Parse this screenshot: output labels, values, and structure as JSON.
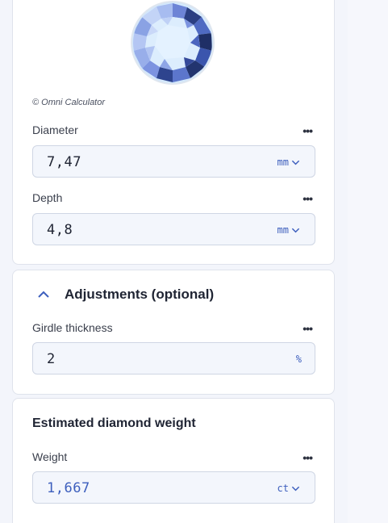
{
  "credit": "© Omni Calculator",
  "icons": {
    "diamond": "diamond-illustration",
    "more": "more-options-icon",
    "chevron": "chevron-down-icon",
    "collapse": "chevron-up-icon"
  },
  "colors": {
    "accent": "#3d5fbd",
    "input_bg": "#f3f6fc",
    "card_border": "#dfe3ec"
  },
  "fields": {
    "diameter": {
      "label": "Diameter",
      "value": "7,47",
      "unit": "mm"
    },
    "depth": {
      "label": "Depth",
      "value": "4,8",
      "unit": "mm"
    }
  },
  "adjustments": {
    "title": "Adjustments (optional)",
    "girdle": {
      "label": "Girdle thickness",
      "value": "2",
      "unit": "%"
    }
  },
  "estimate": {
    "title": "Estimated diamond weight",
    "weight": {
      "label": "Weight",
      "value": "1,667",
      "unit": "ct"
    }
  },
  "more_glyph": "•••"
}
